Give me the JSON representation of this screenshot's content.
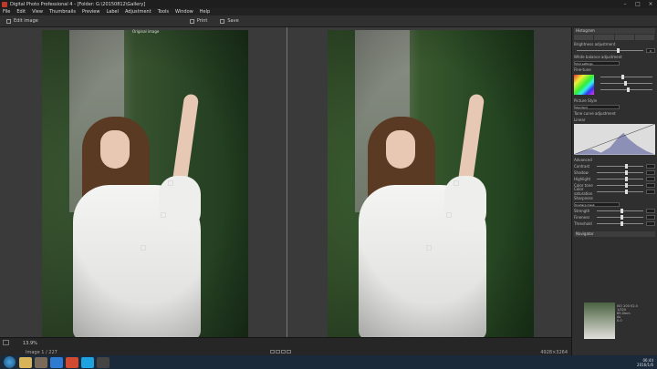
{
  "window": {
    "title": "Digital Photo Professional 4 - [Folder: G:\\20150812\\Gallery]",
    "controls": [
      "minimize",
      "maximize",
      "close"
    ]
  },
  "menu": [
    "File",
    "Edit",
    "View",
    "Thumbnails",
    "Preview",
    "Label",
    "Adjustment",
    "Tools",
    "Window",
    "Help"
  ],
  "toolbar": {
    "edit_image": "Edit image",
    "print": "Print",
    "save": "Save"
  },
  "viewer": {
    "left_label": "Original image"
  },
  "status": {
    "zoom": "13.9%",
    "image_count": "Image 1 / 227",
    "right": "4928×3264"
  },
  "panel": {
    "header": "Histogram",
    "brightness": "Brightness adjustment",
    "brightness_val": "0",
    "wb": "White balance adjustment",
    "wb_val": "0",
    "wb_mode": "Shot settings",
    "finetune": "Fine-tune",
    "picture_style": "Picture Style",
    "picture_style_val": "Standard",
    "tone_curve": "Tone curve adjustment",
    "linear": "Linear",
    "advanced": "Advanced",
    "contrast": "Contrast",
    "shadow": "Shadow",
    "highlight": "Highlight",
    "color_tone": "Color tone",
    "color_saturation": "Color saturation",
    "sharpness": "Sharpness",
    "sharp_mode": "Unsharp mask",
    "strength": "Strength",
    "fineness": "Fineness",
    "threshold": "Threshold",
    "navigator": "Navigator",
    "nav_info": [
      "ISO 200 f/2.0",
      "1/320",
      "85.0mm",
      "Av",
      "0.0"
    ]
  },
  "taskbar": {
    "time": "06:44",
    "date": "2016/1/6",
    "lang": "ENG"
  }
}
